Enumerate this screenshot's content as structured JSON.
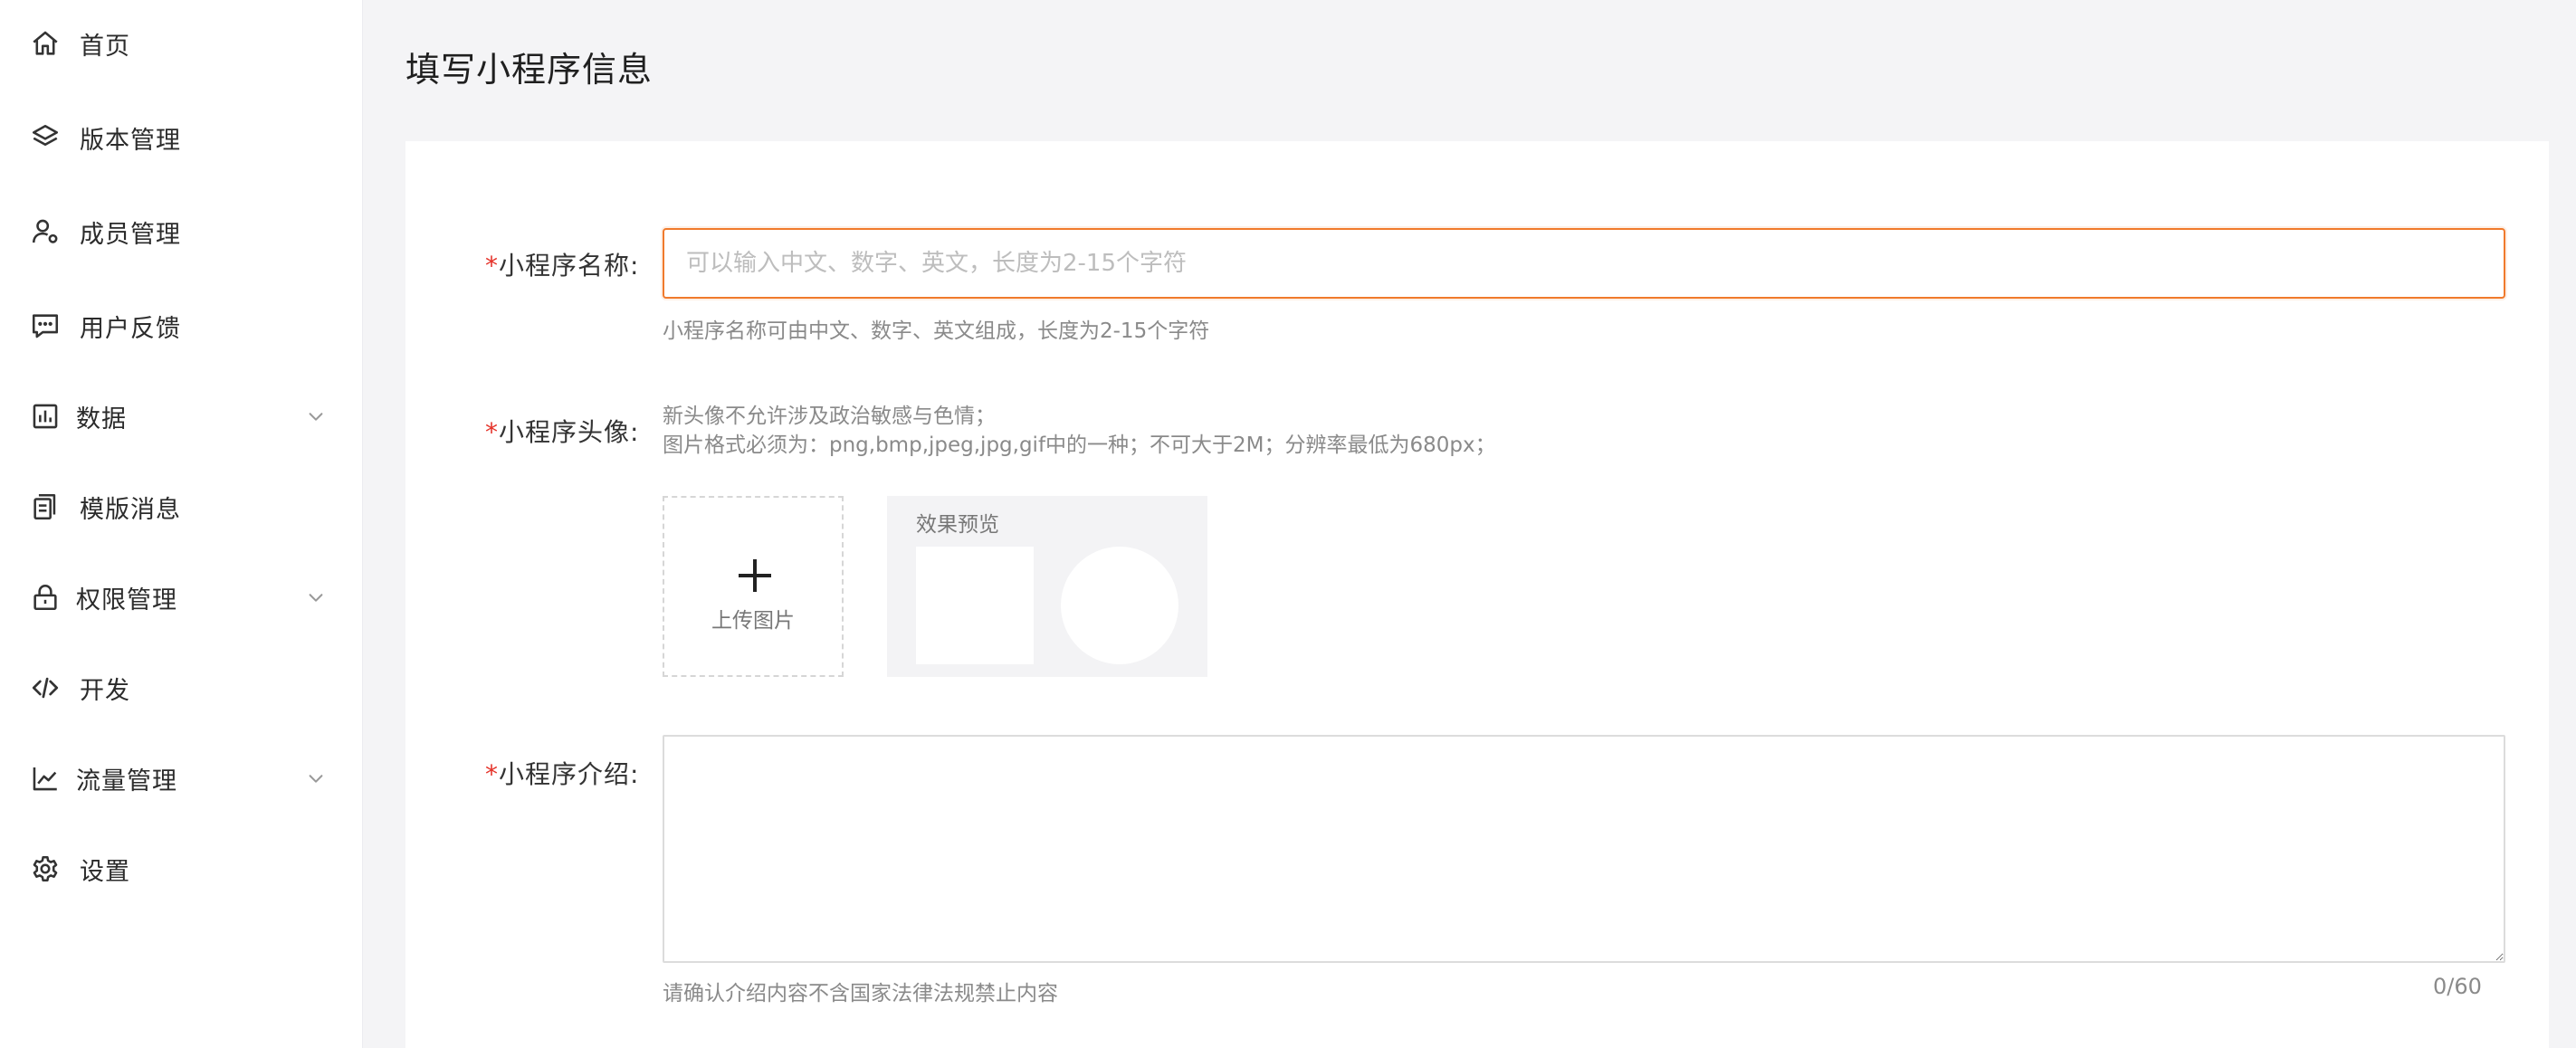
{
  "sidebar": {
    "items": [
      {
        "label": "首页",
        "icon": "home-icon"
      },
      {
        "label": "版本管理",
        "icon": "layers-icon"
      },
      {
        "label": "成员管理",
        "icon": "user-settings-icon"
      },
      {
        "label": "用户反馈",
        "icon": "message-icon"
      },
      {
        "label": "数据",
        "icon": "bar-chart-icon",
        "expandable": true
      },
      {
        "label": "模版消息",
        "icon": "copy-document-icon"
      },
      {
        "label": "权限管理",
        "icon": "lock-icon",
        "expandable": true
      },
      {
        "label": "开发",
        "icon": "code-icon"
      },
      {
        "label": "流量管理",
        "icon": "line-chart-icon",
        "expandable": true
      },
      {
        "label": "设置",
        "icon": "gear-icon"
      }
    ]
  },
  "main": {
    "page_title": "填写小程序信息",
    "form": {
      "required_mark": "*",
      "name": {
        "label": "小程序名称:",
        "value": "",
        "placeholder": "可以输入中文、数字、英文，长度为2-15个字符",
        "hint": "小程序名称可由中文、数字、英文组成，长度为2-15个字符"
      },
      "avatar": {
        "label": "小程序头像:",
        "hint_line1": "新头像不允许涉及政治敏感与色情；",
        "hint_line2": "图片格式必须为：png,bmp,jpeg,jpg,gif中的一种；不可大于2M；分辨率最低为680px；",
        "upload_label": "上传图片",
        "preview_label": "效果预览"
      },
      "intro": {
        "label": "小程序介绍:",
        "value": "",
        "hint": "请确认介绍内容不含国家法律法规禁止内容",
        "counter": "0/60"
      }
    }
  },
  "colors": {
    "accent": "#f07a2c",
    "required": "#e5332a",
    "page_bg": "#f4f4f6"
  }
}
